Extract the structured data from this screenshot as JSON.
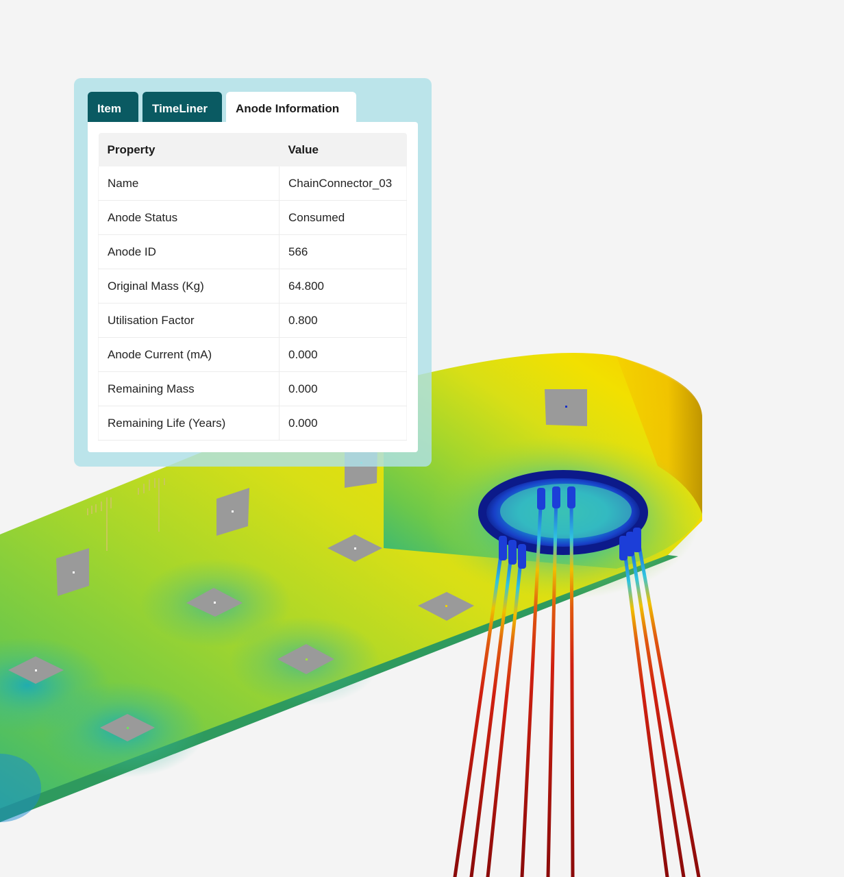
{
  "tabs": [
    {
      "label": "Item",
      "active": false
    },
    {
      "label": "TimeLiner",
      "active": false
    },
    {
      "label": "Anode Information",
      "active": true
    }
  ],
  "table": {
    "headers": [
      "Property",
      "Value"
    ],
    "rows": [
      [
        "Name",
        "ChainConnector_03"
      ],
      [
        "Anode Status",
        "Consumed"
      ],
      [
        "Anode ID",
        "566"
      ],
      [
        "Original Mass (Kg)",
        "64.800"
      ],
      [
        "Utilisation Factor",
        "0.800"
      ],
      [
        "Anode Current (mA)",
        "0.000"
      ],
      [
        "Remaining Mass",
        "0.000"
      ],
      [
        "Remaining Life (Years)",
        "0.000"
      ]
    ]
  },
  "colors": {
    "panel_background": "#afe0e8",
    "tab_inactive": "#0a5a62",
    "tab_active": "#ffffff",
    "page_background": "#f4f4f4",
    "model_high": "#f5c400",
    "model_mid": "#9bd62c",
    "model_low": "#1f3fd6",
    "cable": "#c41818"
  }
}
